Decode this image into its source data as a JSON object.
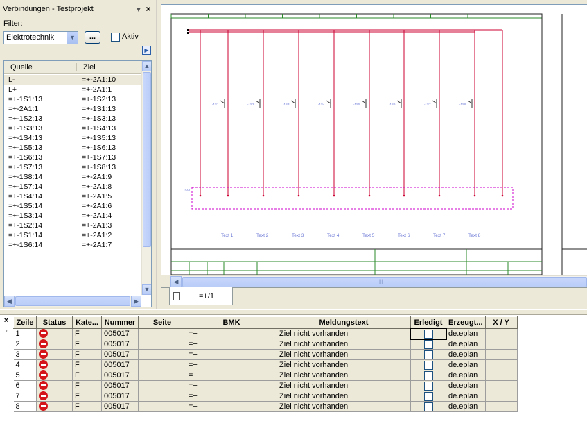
{
  "connections_panel": {
    "title": "Verbindungen - Testprojekt",
    "filter_label": "Filter:",
    "filter_value": "Elektrotechnik",
    "browse_label": "...",
    "aktiv_label": "Aktiv",
    "columns": {
      "source": "Quelle",
      "target": "Ziel"
    },
    "rows": [
      {
        "q": "L-",
        "z": "=+-2A1:10"
      },
      {
        "q": "L+",
        "z": "=+-2A1:1"
      },
      {
        "q": "=+-1S1:13",
        "z": "=+-1S2:13"
      },
      {
        "q": "=+-2A1:1",
        "z": "=+-1S1:13"
      },
      {
        "q": "=+-1S2:13",
        "z": "=+-1S3:13"
      },
      {
        "q": "=+-1S3:13",
        "z": "=+-1S4:13"
      },
      {
        "q": "=+-1S4:13",
        "z": "=+-1S5:13"
      },
      {
        "q": "=+-1S5:13",
        "z": "=+-1S6:13"
      },
      {
        "q": "=+-1S6:13",
        "z": "=+-1S7:13"
      },
      {
        "q": "=+-1S7:13",
        "z": "=+-1S8:13"
      },
      {
        "q": "=+-1S8:14",
        "z": "=+-2A1:9"
      },
      {
        "q": "=+-1S7:14",
        "z": "=+-2A1:8"
      },
      {
        "q": "=+-1S4:14",
        "z": "=+-2A1:5"
      },
      {
        "q": "=+-1S5:14",
        "z": "=+-2A1:6"
      },
      {
        "q": "=+-1S3:14",
        "z": "=+-2A1:4"
      },
      {
        "q": "=+-1S2:14",
        "z": "=+-2A1:3"
      },
      {
        "q": "=+-1S1:14",
        "z": "=+-2A1:2"
      },
      {
        "q": "=+-1S6:14",
        "z": "=+-2A1:7"
      }
    ]
  },
  "drawing": {
    "text_labels": [
      "Text 1",
      "Text 2",
      "Text 3",
      "Text 4",
      "Text 5",
      "Text 6",
      "Text 7",
      "Text 8"
    ],
    "switch_labels": [
      "-1S1",
      "-1S2",
      "-1S3",
      "-1S4",
      "-1S5",
      "-1S6",
      "-1S7",
      "-1S8"
    ],
    "terminal_label": "-2A1",
    "wire_color": "#cc0033",
    "terminal_box_color": "#cc00cc",
    "label_color": "#6b78d6",
    "page_tab": "=+/1"
  },
  "messages": {
    "columns": [
      "Zeile",
      "Status",
      "Kate...",
      "Nummer",
      "Seite",
      "BMK",
      "Meldungstext",
      "Erledigt",
      "Erzeugt...",
      "X / Y"
    ],
    "rows": [
      {
        "zeile": "1",
        "kategorie": "F",
        "nummer": "005017",
        "seite": "",
        "bmk": "=+",
        "text": "Ziel nicht vorhanden",
        "erzeugt": "de.eplan",
        "xy": ""
      },
      {
        "zeile": "2",
        "kategorie": "F",
        "nummer": "005017",
        "seite": "",
        "bmk": "=+",
        "text": "Ziel nicht vorhanden",
        "erzeugt": "de.eplan",
        "xy": ""
      },
      {
        "zeile": "3",
        "kategorie": "F",
        "nummer": "005017",
        "seite": "",
        "bmk": "=+",
        "text": "Ziel nicht vorhanden",
        "erzeugt": "de.eplan",
        "xy": ""
      },
      {
        "zeile": "4",
        "kategorie": "F",
        "nummer": "005017",
        "seite": "",
        "bmk": "=+",
        "text": "Ziel nicht vorhanden",
        "erzeugt": "de.eplan",
        "xy": ""
      },
      {
        "zeile": "5",
        "kategorie": "F",
        "nummer": "005017",
        "seite": "",
        "bmk": "=+",
        "text": "Ziel nicht vorhanden",
        "erzeugt": "de.eplan",
        "xy": ""
      },
      {
        "zeile": "6",
        "kategorie": "F",
        "nummer": "005017",
        "seite": "",
        "bmk": "=+",
        "text": "Ziel nicht vorhanden",
        "erzeugt": "de.eplan",
        "xy": ""
      },
      {
        "zeile": "7",
        "kategorie": "F",
        "nummer": "005017",
        "seite": "",
        "bmk": "=+",
        "text": "Ziel nicht vorhanden",
        "erzeugt": "de.eplan",
        "xy": ""
      },
      {
        "zeile": "8",
        "kategorie": "F",
        "nummer": "005017",
        "seite": "",
        "bmk": "=+",
        "text": "Ziel nicht vorhanden",
        "erzeugt": "de.eplan",
        "xy": ""
      }
    ]
  }
}
